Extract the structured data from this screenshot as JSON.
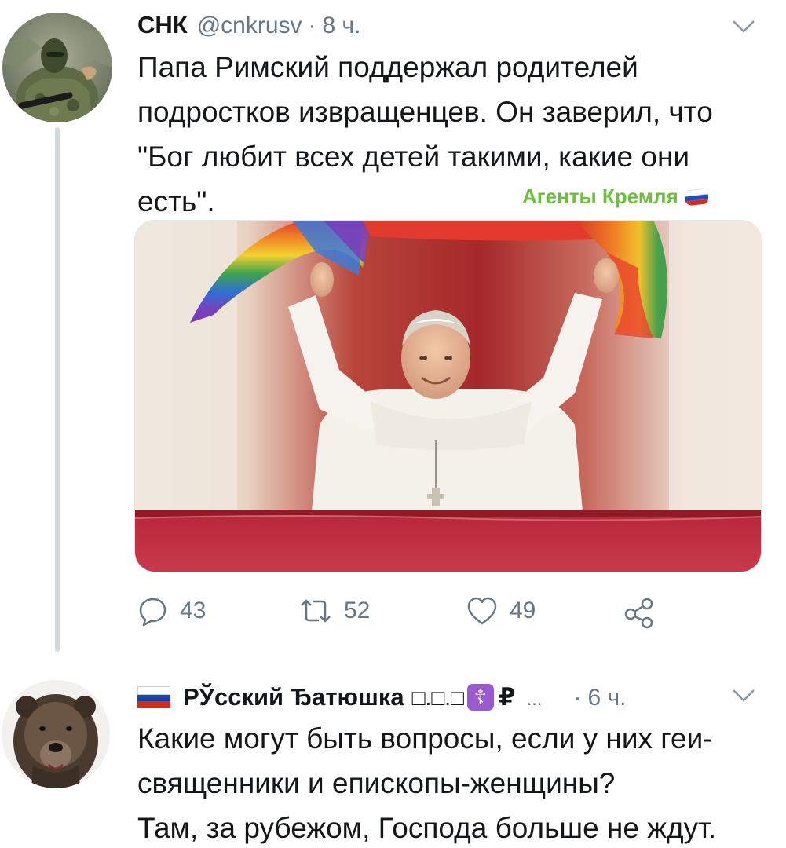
{
  "tweet1": {
    "name": "СНК",
    "handle": "@cnkrusv",
    "separator": "·",
    "time": "8 ч.",
    "text_lines": [
      "Папа Римский поддержал родителей",
      "подростков извращенцев.  Он заверил, что",
      "\"Бог любит всех детей такими, какие они",
      "есть\"."
    ],
    "watermark": "Агенты Кремля",
    "actions": {
      "replies": "43",
      "retweets": "52",
      "likes": "49"
    }
  },
  "tweet2": {
    "name": "РЎсский Ђатюшка",
    "boxes": "□.□.□",
    "badge_symbol": "☦",
    "ruble": "₽",
    "ellipsis": "...",
    "separator": "·",
    "time": "6 ч.",
    "text_lines": [
      "Какие могут быть вопросы, если у них геи-",
      "священники и епископы-женщины?",
      "Там, за рубежом, Господа больше не ждут."
    ]
  },
  "icons": [
    "avatar-soldier",
    "chevron-down-icon",
    "reply-icon",
    "retweet-icon",
    "like-icon",
    "share-icon",
    "russia-flag-icon",
    "orthodox-cross-icon",
    "avatar-bear"
  ],
  "colors": {
    "text": "#14171a",
    "secondary": "#657786",
    "thread_line": "#cfd9de",
    "watermark_green": "#6bbf3a",
    "badge_purple": "#9b59d0"
  }
}
